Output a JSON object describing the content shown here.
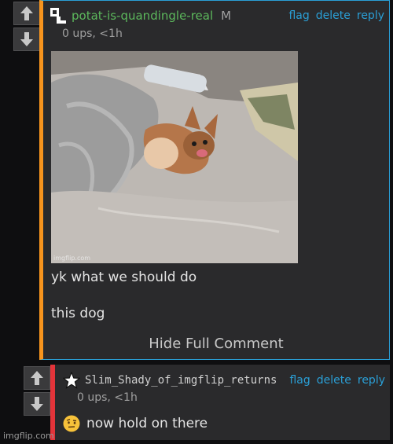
{
  "comments": [
    {
      "username": "potat-is-quandingle-real",
      "gender": "M",
      "actions": [
        "flag",
        "delete",
        "reply"
      ],
      "meta": "0 ups, <1h",
      "image_watermark": "imgflip.com",
      "lines": [
        "yk what we should do",
        "this dog"
      ],
      "toggle_label": "Hide Full Comment",
      "accent_color": "#f7941d",
      "username_color": "#5cb85c"
    },
    {
      "username": "Slim_Shady_of_imgflip_returns",
      "actions": [
        "flag",
        "delete",
        "reply"
      ],
      "meta": "0 ups, <1h",
      "emoji": "raised-eyebrow-emoji",
      "text": "now hold on there",
      "accent_color": "#e3343a"
    }
  ],
  "icons": {
    "upvote": "arrow-up-icon",
    "downvote": "arrow-down-icon"
  },
  "site_watermark": "imgflip.com",
  "colors": {
    "link": "#2a9fd6",
    "background": "#0e0e10",
    "panel": "#2a2a2c"
  }
}
